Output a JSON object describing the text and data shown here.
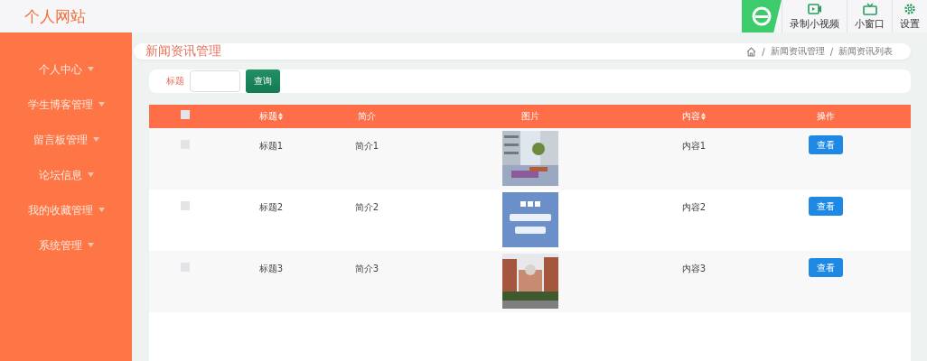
{
  "site_title": "个人网站",
  "toolbar": [
    {
      "kind": "video",
      "label": "录制小视频"
    },
    {
      "kind": "window",
      "label": "小窗口"
    },
    {
      "kind": "gear",
      "label": "设置"
    }
  ],
  "sidebar": {
    "items": [
      {
        "label": "个人中心",
        "expanded": false
      },
      {
        "label": "学生博客管理",
        "expanded": false
      },
      {
        "label": "留言板管理",
        "expanded": false
      },
      {
        "label": "论坛信息",
        "expanded": false
      },
      {
        "label": "我的收藏管理",
        "expanded": false
      },
      {
        "label": "系统管理",
        "expanded": false
      }
    ]
  },
  "page_title": "新闻资讯管理",
  "breadcrumb": [
    {
      "separator": "/",
      "label": "新闻资讯管理"
    },
    {
      "separator": "/",
      "label": "新闻资讯列表"
    }
  ],
  "search": {
    "label": "标题",
    "button": "查询"
  },
  "table": {
    "select_all_checked": false,
    "columns": [
      {
        "kind": "check"
      },
      {
        "kind": "text",
        "label": "标题",
        "sortable": true
      },
      {
        "kind": "text",
        "label": "简介",
        "sortable": false
      },
      {
        "kind": "text",
        "label": "图片",
        "sortable": false
      },
      {
        "kind": "text",
        "label": "内容",
        "sortable": true
      },
      {
        "kind": "text",
        "label": "操作",
        "sortable": false
      }
    ],
    "rows": [
      {
        "checked": false,
        "title": "标题1",
        "summary": "简介1",
        "content": "内容1",
        "action": "查看"
      },
      {
        "checked": false,
        "title": "标题2",
        "summary": "简介2",
        "content": "内容2",
        "action": "查看"
      },
      {
        "checked": false,
        "title": "标题3",
        "summary": "简介3",
        "content": "内容3",
        "action": "查看"
      }
    ]
  }
}
